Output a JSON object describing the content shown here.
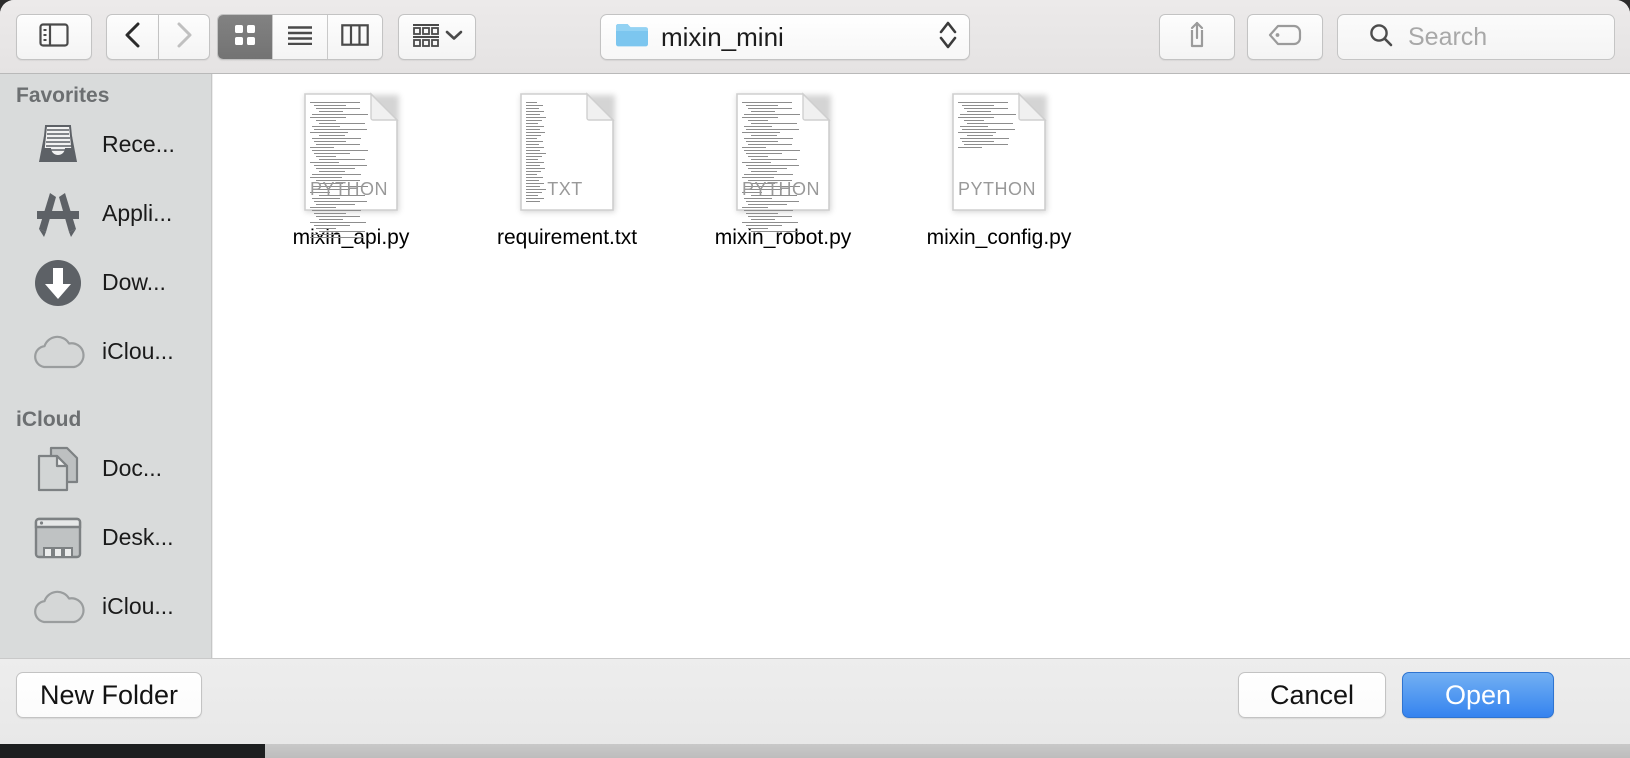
{
  "window": {
    "title": "mixin_mini"
  },
  "toolbar": {
    "sidebar_toggle": "sidebar-toggle-icon",
    "back": "chevron-left-icon",
    "forward": "chevron-right-icon",
    "view_modes": [
      {
        "name": "icon-view",
        "icon": "grid-icon",
        "selected": true
      },
      {
        "name": "list-view",
        "icon": "list-icon",
        "selected": false
      },
      {
        "name": "column-view",
        "icon": "columns-icon",
        "selected": false
      }
    ],
    "group_by": {
      "icon": "group-items-icon",
      "chevron": "chevron-down-icon"
    },
    "share": "share-icon",
    "tag": "tag-icon",
    "path_popup": {
      "folder_icon": "folder-icon",
      "label": "mixin_mini",
      "stepper": "up-down-chevrons-icon"
    },
    "search": {
      "icon": "search-icon",
      "placeholder": "Search",
      "value": ""
    }
  },
  "sidebar": {
    "sections": [
      {
        "header": "Favorites",
        "items": [
          {
            "label": "Rece...",
            "icon": "recents-icon"
          },
          {
            "label": "Appli...",
            "icon": "applications-icon"
          },
          {
            "label": "Dow...",
            "icon": "downloads-icon"
          },
          {
            "label": "iClou...",
            "icon": "icloud-icon"
          }
        ]
      },
      {
        "header": "iCloud",
        "items": [
          {
            "label": "Doc...",
            "icon": "documents-icon"
          },
          {
            "label": "Desk...",
            "icon": "desktop-icon"
          },
          {
            "label": "iClou...",
            "icon": "icloud-icon"
          }
        ]
      }
    ]
  },
  "content": {
    "files": [
      {
        "name": "mixin_api.py",
        "badge": "PYTHON",
        "kind": "python",
        "icon": "python-file-icon",
        "line_count": 46,
        "line_style": "code"
      },
      {
        "name": "requirement.txt",
        "badge": "TXT",
        "kind": "text",
        "icon": "text-file-icon",
        "line_count": 34,
        "line_style": "short"
      },
      {
        "name": "mixin_robot.py",
        "badge": "PYTHON",
        "kind": "python",
        "icon": "python-file-icon",
        "line_count": 44,
        "line_style": "code"
      },
      {
        "name": "mixin_config.py",
        "badge": "PYTHON",
        "kind": "python",
        "icon": "python-file-icon",
        "line_count": 16,
        "line_style": "code"
      }
    ]
  },
  "footer": {
    "new_folder_label": "New Folder",
    "cancel_label": "Cancel",
    "open_label": "Open"
  },
  "colors": {
    "accent": "#3583ef",
    "sidebar_bg": "#d9dbdb",
    "content_bg": "#ffffff",
    "toolbar_bg": "#eceaea",
    "selected_segment": "#7a7a7a"
  }
}
